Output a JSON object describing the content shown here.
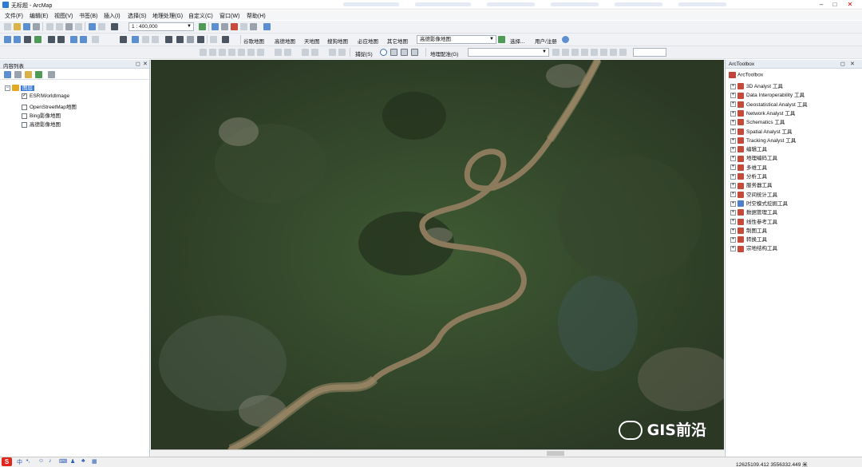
{
  "window": {
    "title": "无标题 - ArcMap",
    "controls": [
      "minimize-icon",
      "maximize-icon",
      "close-icon"
    ]
  },
  "menubar": {
    "items": [
      "文件(F)",
      "编辑(E)",
      "视图(V)",
      "书签(B)",
      "插入(I)",
      "选择(S)",
      "地理处理(G)",
      "自定义(C)",
      "窗口(W)",
      "帮助(H)"
    ]
  },
  "toolbar": {
    "scale": "1 : 400,000",
    "basemap_buttons": [
      "谷歌地图",
      "高德地图",
      "天地图",
      "搜狗地图",
      "必应地图",
      "其它地图",
      "高德影像地图"
    ],
    "user_button": "用户/注册",
    "select_label": "选择...",
    "snapping_label": "捕捉(S)",
    "georef_label": "地理配准(G)"
  },
  "toc": {
    "title": "内容列表",
    "root": "图层",
    "layers": [
      {
        "name": "ESRIWorldImage",
        "checked": true
      },
      {
        "name": "OpenStreetMap地图",
        "checked": false
      },
      {
        "name": "Bing影像地图",
        "checked": false
      },
      {
        "name": "高德影像地图",
        "checked": false
      }
    ]
  },
  "arctoolbox": {
    "title": "ArcToolbox",
    "root": "ArcToolbox",
    "items": [
      "3D Analyst 工具",
      "Data Interoperability 工具",
      "Geostatistical Analyst 工具",
      "Network Analyst 工具",
      "Schematics 工具",
      "Spatial Analyst 工具",
      "Tracking Analyst 工具",
      "编辑工具",
      "地理编码工具",
      "多维工具",
      "分析工具",
      "服务器工具",
      "空间统计工具",
      "时空模式挖掘工具",
      "数据管理工具",
      "线性参考工具",
      "制图工具",
      "转换工具",
      "宗地结构工具"
    ]
  },
  "statusbar": {
    "coords": "12625109.412  3556332.449 米"
  },
  "watermark": {
    "text": "GIS前沿"
  },
  "ime": {
    "logo": "S",
    "label": "中"
  },
  "colors": {
    "map_base": "#2d3a26",
    "river": "#8b7a5c",
    "selection": "#3a7bd5"
  }
}
